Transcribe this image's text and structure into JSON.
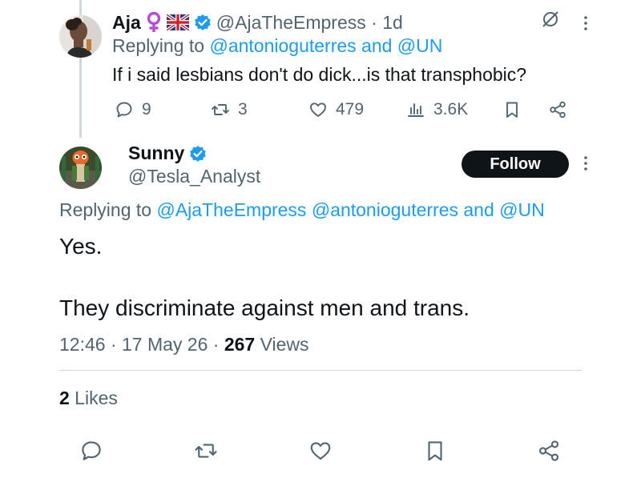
{
  "parent": {
    "name": "Aja",
    "emoji_icons": [
      "female-sign-icon",
      "uk-flag-icon"
    ],
    "handle_time": "@AjaTheEmpress · 1d",
    "replying_prefix": "Replying to ",
    "replying_targets": "@antonioguterres and @UN",
    "text": "If i said lesbians don't do dick...is that transphobic?",
    "stats": {
      "replies": "9",
      "reposts": "3",
      "likes": "479",
      "views": "3.6K"
    }
  },
  "main": {
    "name": "Sunny",
    "handle": "@Tesla_Analyst",
    "follow_label": "Follow",
    "replying_prefix": "Replying to ",
    "replying_targets": "@AjaTheEmpress @antonioguterres and @UN",
    "text_line1": "Yes.",
    "text_line2": "They discriminate against men and trans.",
    "timestamp": "12:46 · 17 May 26 · ",
    "views_count": "267",
    "views_label": " Views",
    "likes_count": "2",
    "likes_label": " Likes"
  },
  "colors": {
    "accent": "#1d9bf0",
    "text": "#0f1419",
    "muted": "#536471",
    "divider": "#cfd9de"
  }
}
